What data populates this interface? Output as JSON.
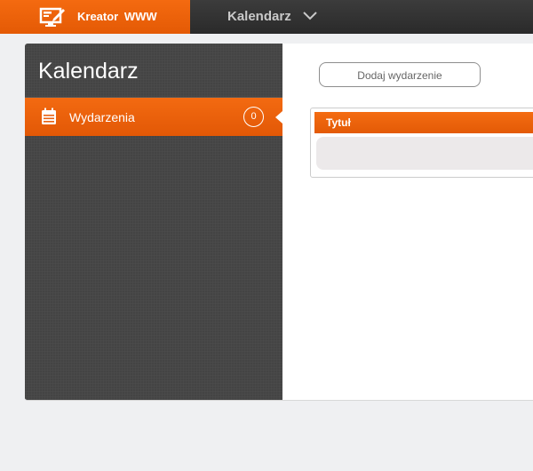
{
  "header": {
    "brand_label": "Kreator WWW",
    "nav_title": "Kalendarz",
    "icons": {
      "brand": "monitor-edit-icon",
      "nav_dropdown": "chevron-down-icon"
    }
  },
  "sidebar": {
    "title": "Kalendarz",
    "items": [
      {
        "label": "Wydarzenia",
        "count": "0",
        "icon": "calendar-icon",
        "active": true
      }
    ]
  },
  "main": {
    "add_button_label": "Dodaj wydarzenie",
    "table": {
      "columns": [
        "Tytuł"
      ],
      "rows": []
    }
  },
  "colors": {
    "accent": "#f06410",
    "topbar": "#333333",
    "sidebar": "#444444",
    "background": "#eff0f2"
  }
}
